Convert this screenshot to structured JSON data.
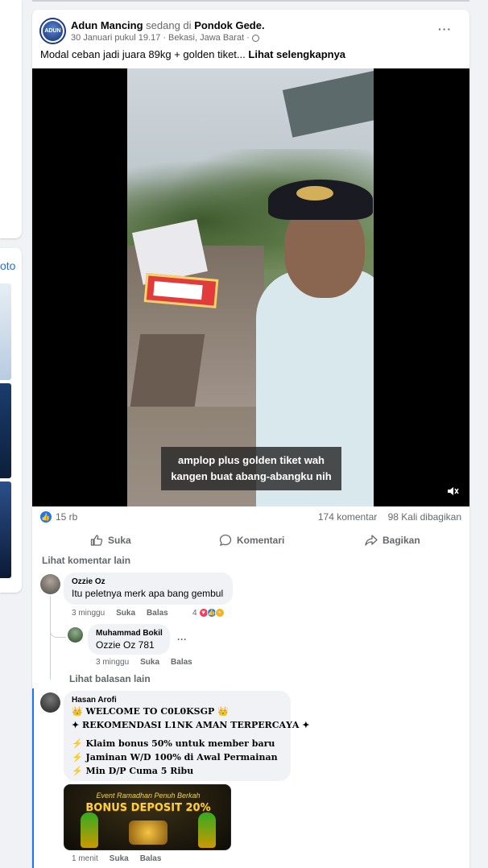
{
  "left_column": {
    "link_text": "oto"
  },
  "post": {
    "author": "Adun Mancing",
    "at_text": "sedang di",
    "place": "Pondok Gede.",
    "date": "30 Januari pukul 19.17",
    "location": "Bekasi, Jawa Barat",
    "sep": "·",
    "avatar_text": "ADUN",
    "caption": "Modal ceban jadi juara 89kg + golden tiket...",
    "see_more": "Lihat selengkapnya",
    "more_menu": "···",
    "video": {
      "subtitle_line1": "amplop plus golden tiket wah",
      "subtitle_line2": "kangen buat abang-abangku nih"
    },
    "stats": {
      "reactions": "15 rb",
      "comments": "174 komentar",
      "shares": "98 Kali dibagikan"
    },
    "actions": {
      "like": "Suka",
      "comment": "Komentari",
      "share": "Bagikan"
    }
  },
  "comments": {
    "more_label": "Lihat komentar lain",
    "c1": {
      "name": "Ozzie Oz",
      "text": "Itu peletnya merk apa bang gembul",
      "time": "3 minggu",
      "like": "Suka",
      "reply": "Balas",
      "reaction_count": "4"
    },
    "r1": {
      "name": "Muhammad Bokil",
      "text": "Ozzie Oz 781",
      "time": "3 minggu",
      "like": "Suka",
      "reply": "Balas",
      "dots": "···"
    },
    "more_replies": "Lihat balasan lain",
    "c2": {
      "name": "Hasan Arofi",
      "line1": "👑 𝐖𝐄𝐋𝐂𝐎𝐌𝐄 𝐓𝐎 𝐂𝟎𝐋𝟎𝐊𝐒𝐆𝐏 👑",
      "line2": "✦ 𝐑𝐄𝐊𝐎𝐌𝐄𝐍𝐃𝐀𝐒𝐈 𝐋𝟏𝐍𝐊 𝐀𝐌𝐀𝐍 𝐓𝐄𝐑𝐏𝐄𝐑𝐂𝐀𝐘𝐀 ✦",
      "line3": "⚡ 𝐊𝐥𝐚𝐢𝐦 𝐛𝐨𝐧𝐮𝐬 𝟓𝟎% 𝐮𝐧𝐭𝐮𝐤 𝐦𝐞𝐦𝐛𝐞𝐫 𝐛𝐚𝐫𝐮",
      "line4": "⚡ 𝐉𝐚𝐦𝐢𝐧𝐚𝐧 𝐖/𝐃 𝟏𝟎𝟎% 𝐝𝐢 𝐀𝐰𝐚𝐥 𝐏𝐞𝐫𝐦𝐚𝐢𝐧𝐚𝐧",
      "line5": "⚡ 𝐌𝐢𝐧 𝐃/𝐏 𝐂𝐮𝐦𝐚 𝟓 𝐑𝐢𝐛𝐮",
      "promo_line1": "Event Ramadhan Penuh Berkah",
      "promo_line2": "BONUS DEPOSIT 20%",
      "time": "1 menit",
      "like": "Suka",
      "reply": "Balas"
    }
  },
  "colors": {
    "accent": "#1877f2",
    "bubble": "#f0f2f5",
    "muted": "#65676b"
  }
}
